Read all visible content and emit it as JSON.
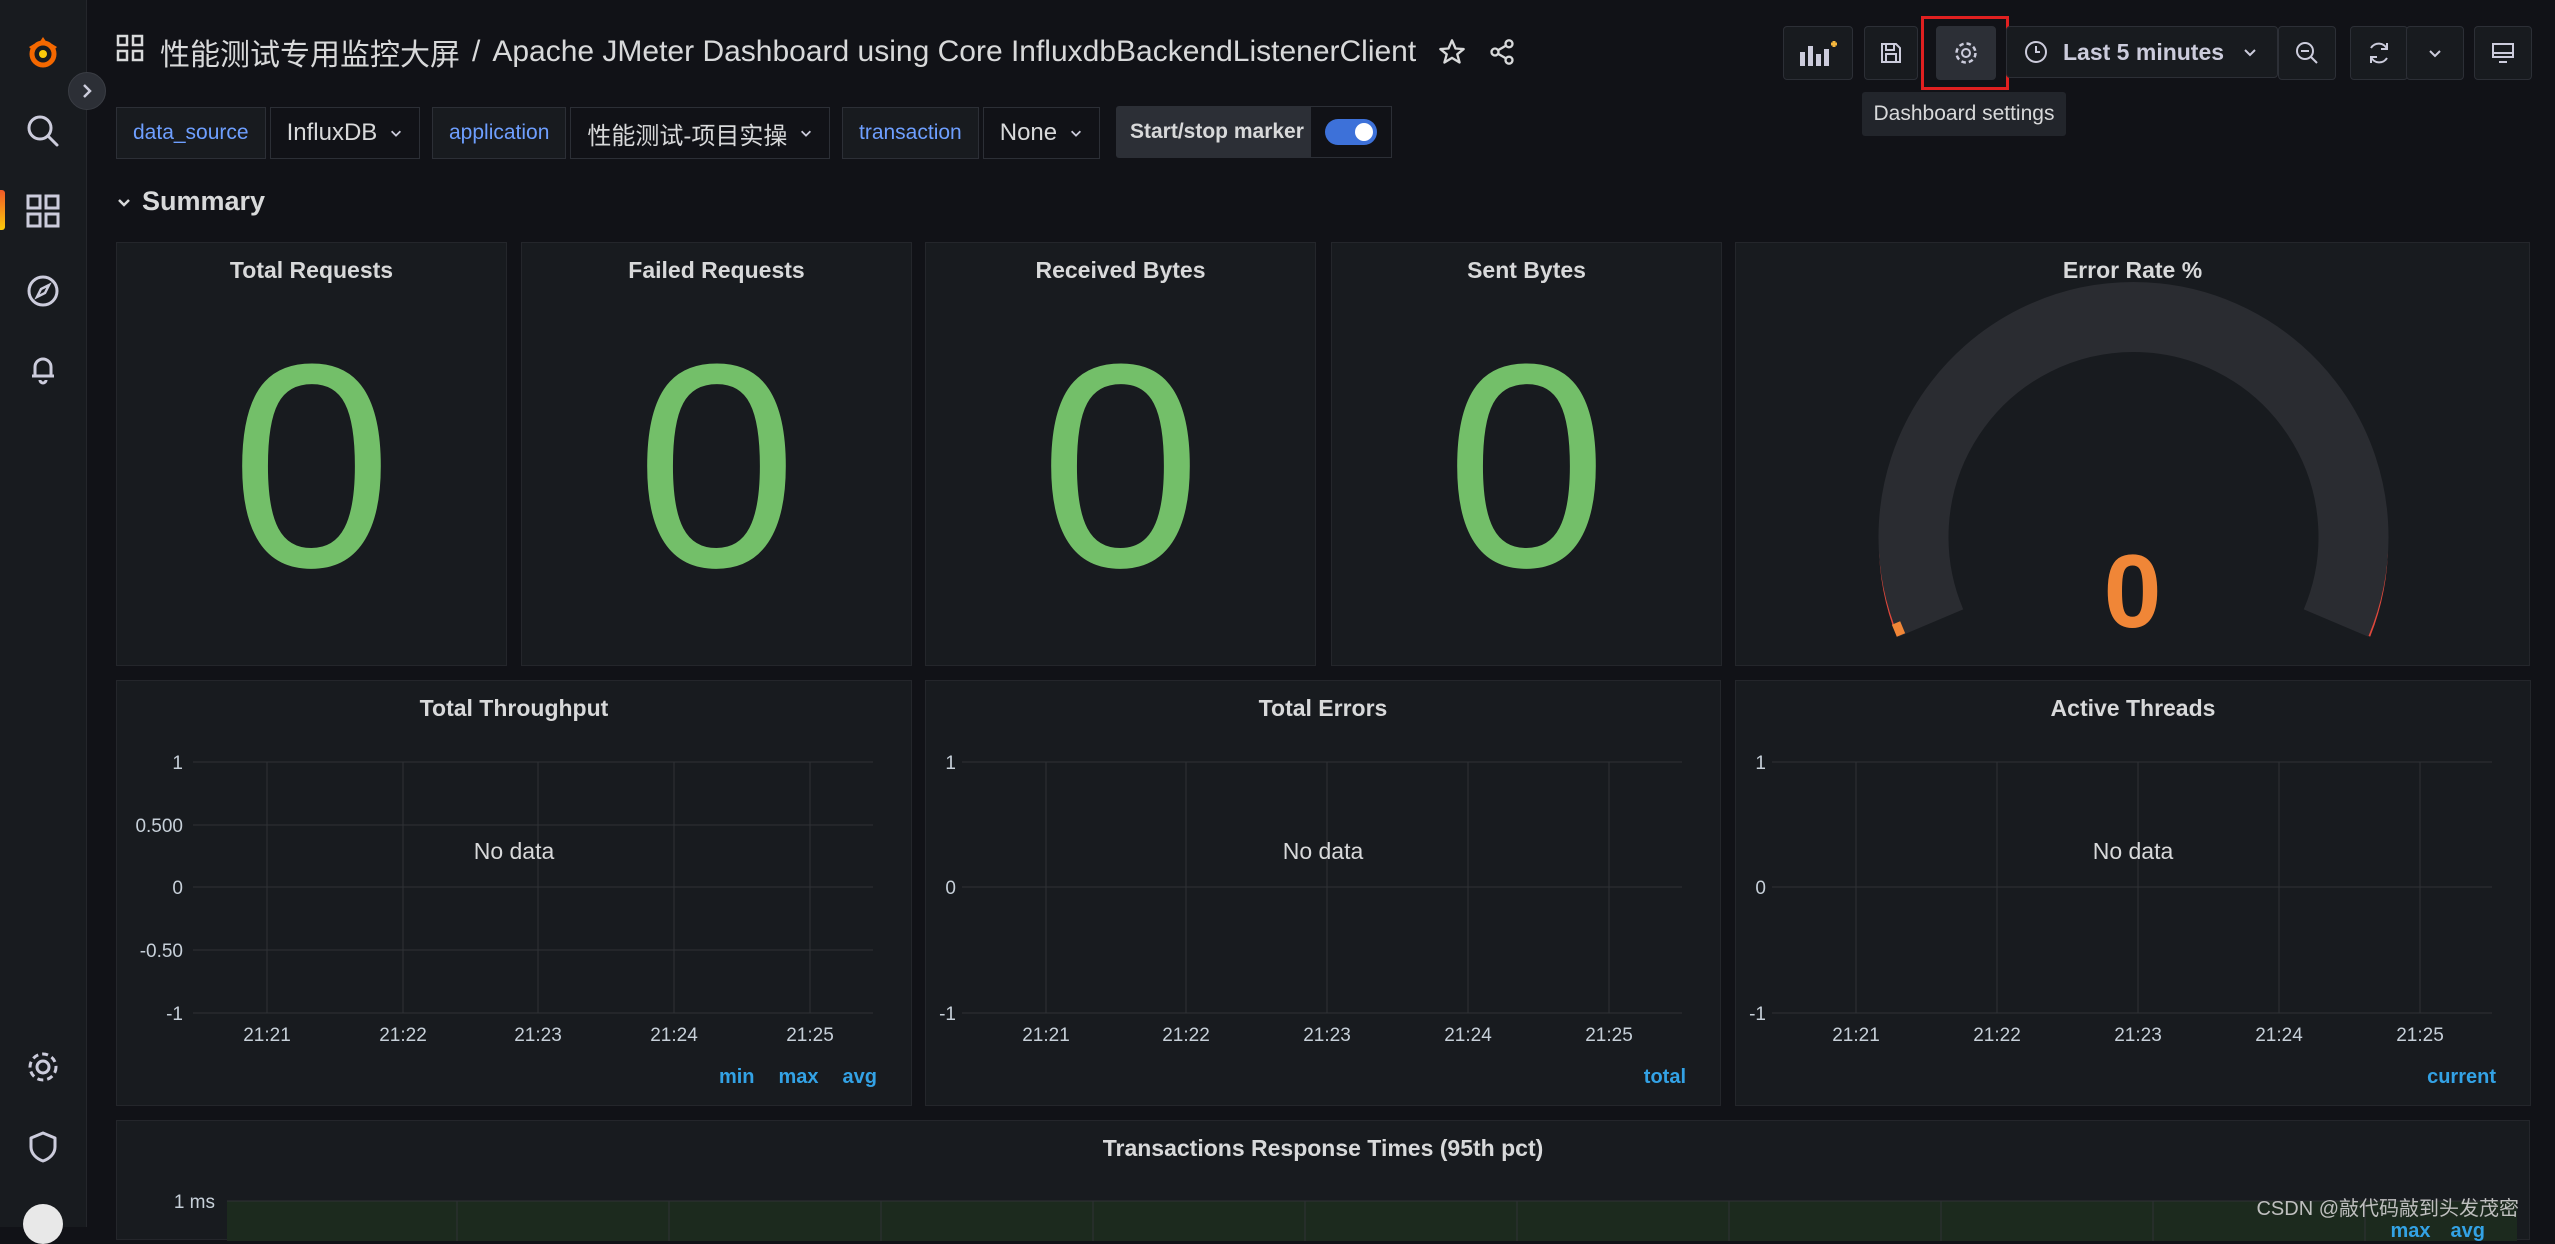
{
  "header": {
    "folder": "性能测试专用监控大屏",
    "separator": "/",
    "dashboard_title": "Apache JMeter Dashboard using Core InfluxdbBackendListenerClient",
    "time_range": "Last 5 minutes",
    "tooltip": "Dashboard settings"
  },
  "variables": [
    {
      "label": "data_source",
      "value": "InfluxDB"
    },
    {
      "label": "application",
      "value": "性能测试-项目实操"
    },
    {
      "label": "transaction",
      "value": "None"
    }
  ],
  "marker_label": "Start/stop marker",
  "row": {
    "title": "Summary"
  },
  "stats": [
    {
      "title": "Total Requests",
      "value": "0"
    },
    {
      "title": "Failed Requests",
      "value": "0"
    },
    {
      "title": "Received Bytes",
      "value": "0"
    },
    {
      "title": "Sent Bytes",
      "value": "0"
    }
  ],
  "gauge": {
    "title": "Error Rate %",
    "value": "0",
    "value_color": "#f08637",
    "arc_color": "#e0483c"
  },
  "graphs": [
    {
      "title": "Total Throughput",
      "nodata": "No data",
      "yticks": [
        "1",
        "0.500",
        "0",
        "-0.50",
        "-1"
      ],
      "xticks": [
        "21:21",
        "21:22",
        "21:23",
        "21:24",
        "21:25"
      ],
      "legend": [
        "min",
        "max",
        "avg"
      ]
    },
    {
      "title": "Total Errors",
      "nodata": "No data",
      "yticks": [
        "1",
        "0",
        "-1"
      ],
      "xticks": [
        "21:21",
        "21:22",
        "21:23",
        "21:24",
        "21:25"
      ],
      "legend": [
        "total"
      ]
    },
    {
      "title": "Active Threads",
      "nodata": "No data",
      "yticks": [
        "1",
        "0",
        "-1"
      ],
      "xticks": [
        "21:21",
        "21:22",
        "21:23",
        "21:24",
        "21:25"
      ],
      "legend": [
        "current"
      ]
    }
  ],
  "bottom_panel": {
    "title": "Transactions Response Times (95th pct)",
    "ytick": "1 ms",
    "legend": [
      "max",
      "avg"
    ]
  },
  "watermark": "CSDN @敲代码敲到头发茂密",
  "colors": {
    "accent": "#6e9fff",
    "stat_green": "#73bf69",
    "legend_blue": "#33a2e5",
    "highlight": "#e02020"
  }
}
